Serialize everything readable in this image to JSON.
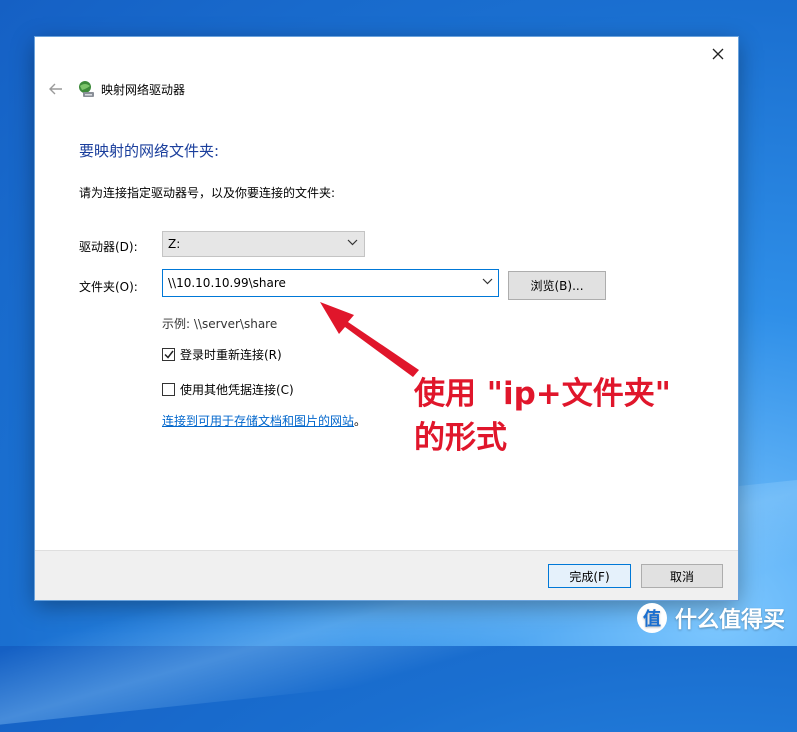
{
  "wizard": {
    "title": "映射网络驱动器",
    "heading": "要映射的网络文件夹:",
    "instruction": "请为连接指定驱动器号，以及你要连接的文件夹:"
  },
  "form": {
    "drive_label": "驱动器(D):",
    "drive_value": "Z:",
    "folder_label": "文件夹(O):",
    "folder_value": "\\\\10.10.10.99\\share",
    "browse_label": "浏览(B)...",
    "example": "示例: \\\\server\\share",
    "reconnect_label": "登录时重新连接(R)",
    "reconnect_checked": true,
    "other_creds_label": "使用其他凭据连接(C)",
    "other_creds_checked": false,
    "site_link": "连接到可用于存储文档和图片的网站",
    "site_link_suffix": "。"
  },
  "footer": {
    "finish_label": "完成(F)",
    "cancel_label": "取消"
  },
  "annotation": {
    "line1": "使用 \"ip+文件夹\"",
    "line2": "的形式",
    "color": "#e0162b"
  },
  "watermark": {
    "logo_char": "值",
    "text": "什么值得买"
  },
  "icons": {
    "close": "close-icon",
    "back": "back-arrow-icon",
    "network_drive": "network-drive-icon",
    "dropdown": "chevron-down-icon",
    "check": "checkmark-icon"
  },
  "colors": {
    "heading": "#1a3e9c",
    "link": "#0066cc",
    "focus_border": "#0078d7"
  }
}
